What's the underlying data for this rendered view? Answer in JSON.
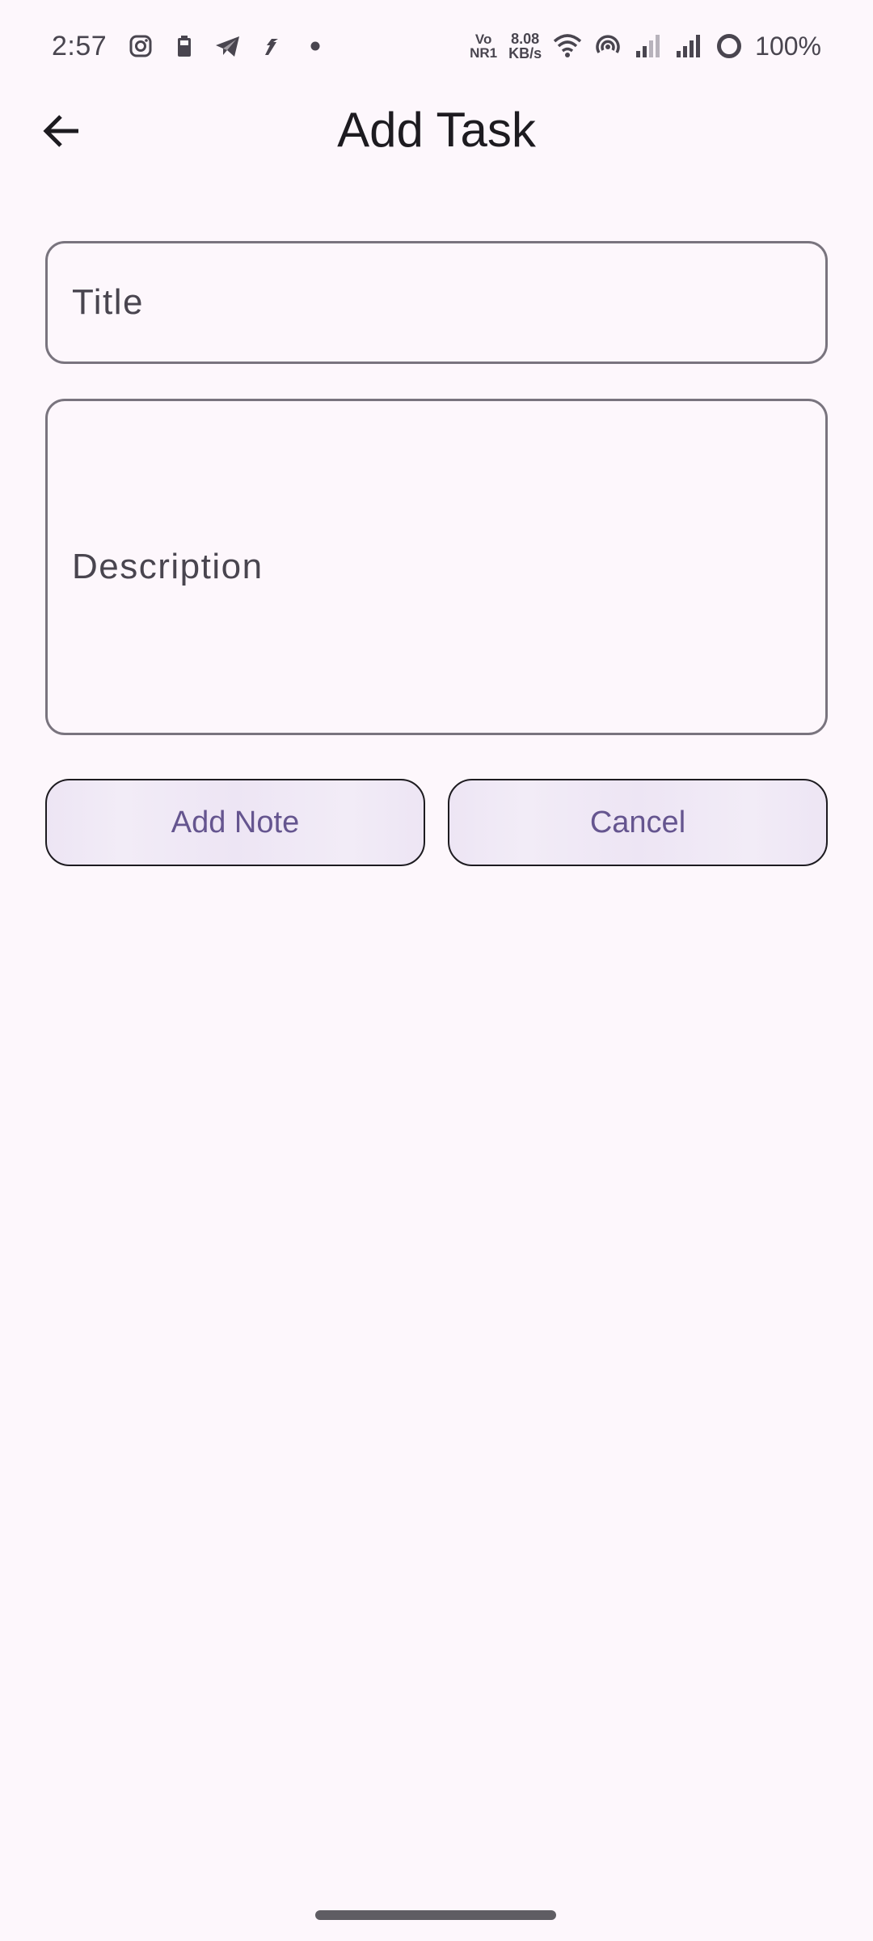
{
  "status_bar": {
    "time": "2:57",
    "network_top": "Vo",
    "network_bottom": "NR1",
    "speed_value": "8.08",
    "speed_unit": "KB/s",
    "battery": "100%",
    "icons": [
      "instagram-icon",
      "battery-saver-icon",
      "telegram-icon",
      "fantasy-app-icon",
      "dot-icon",
      "wifi-icon",
      "hotspot-icon",
      "signal-1-icon",
      "signal-2-icon",
      "battery-ring-icon"
    ]
  },
  "app_bar": {
    "title": "Add Task",
    "back_icon": "arrow-back-icon"
  },
  "form": {
    "title_label": "Title",
    "description_label": "Description"
  },
  "actions": {
    "add_label": "Add Note",
    "cancel_label": "Cancel"
  },
  "colors": {
    "background": "#fdf7fc",
    "outline": "#79747e",
    "button_text": "#65558f",
    "button_fill": "#ede5f4"
  }
}
